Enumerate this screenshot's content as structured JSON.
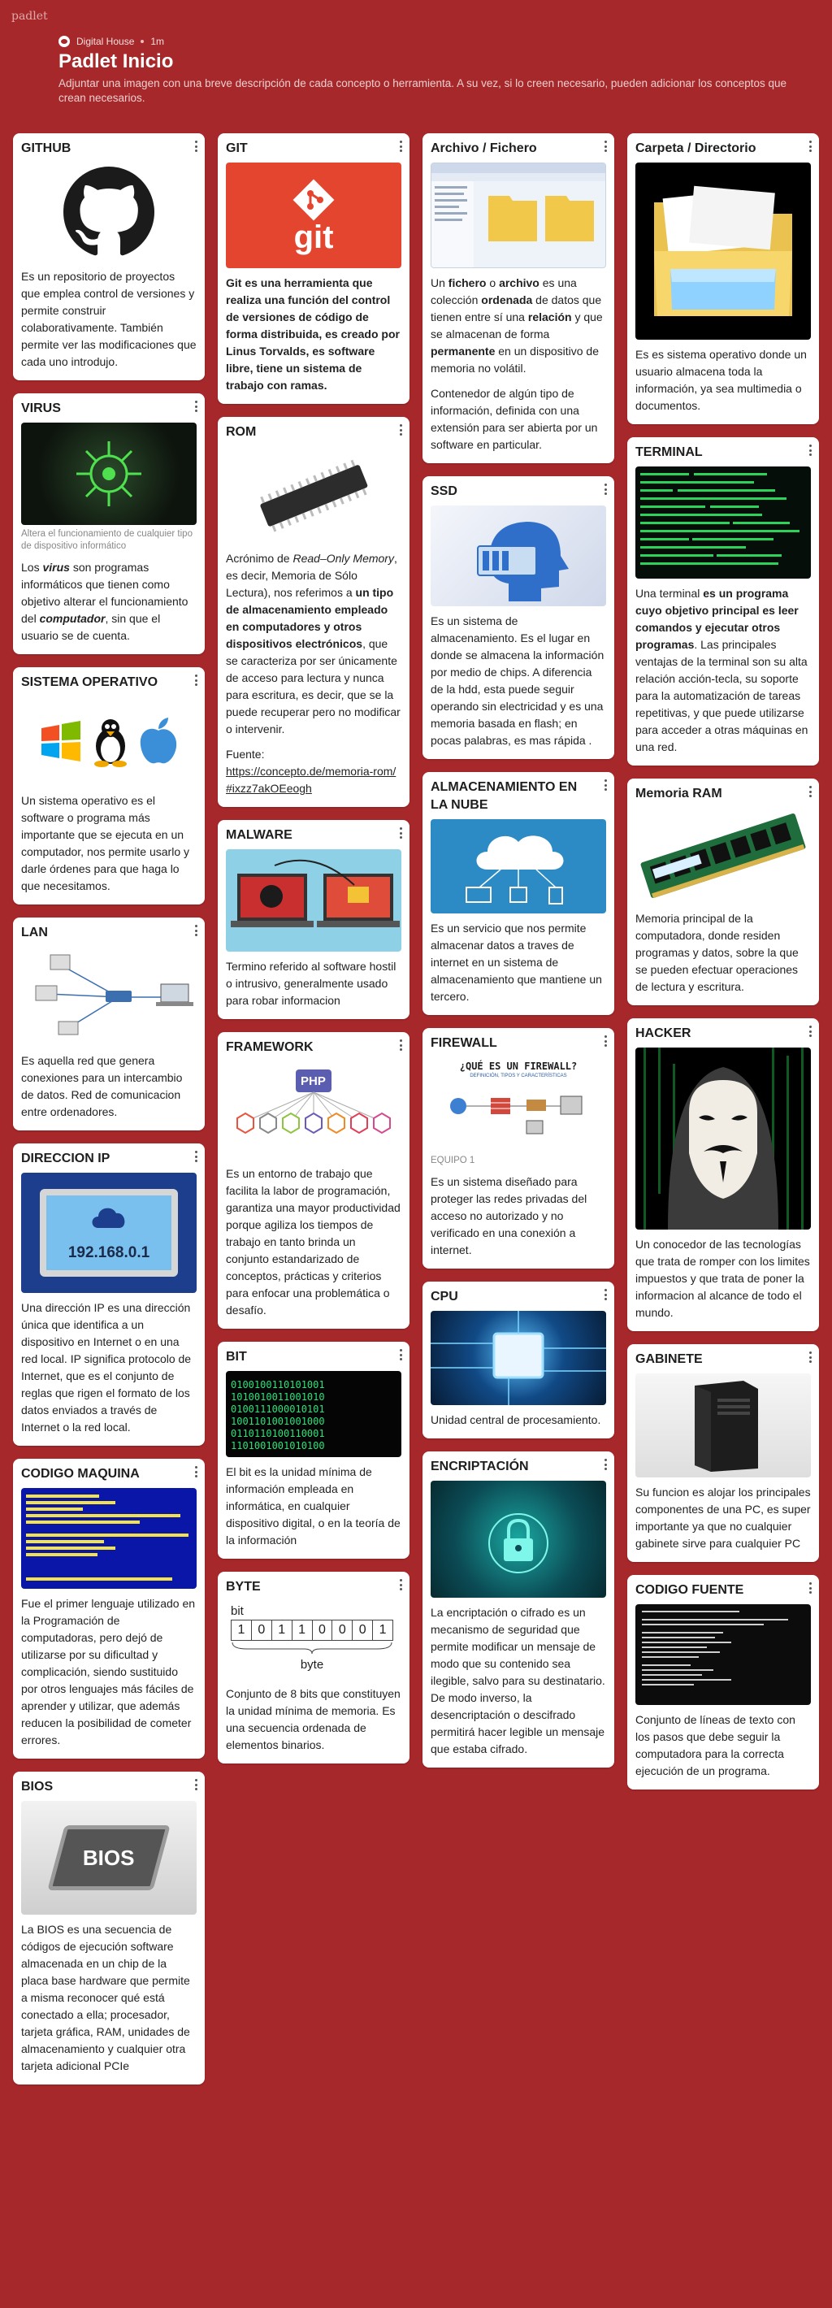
{
  "app": {
    "brand": "padlet"
  },
  "header": {
    "author": "Digital House",
    "time": "1m",
    "title": "Padlet Inicio",
    "description": "Adjuntar una imagen con una breve descripción de cada concepto o herramienta. A su vez, si lo creen necesario, pueden adicionar los conceptos que crean necesarios."
  },
  "colors": {
    "background": "#a7282a",
    "card": "#ffffff"
  },
  "cards": {
    "github": {
      "title": "GITHUB",
      "body": "Es un repositorio de proyectos que emplea control de versiones y permite construir colaborativamente. También permite ver las modificaciones que cada uno introdujo."
    },
    "virus": {
      "title": "VIRUS",
      "caption": "Altera el funcionamiento de cualquier tipo de dispositivo informático",
      "b1": "Los ",
      "b2": "virus",
      "b3": " son programas informáticos que tienen como objetivo alterar el funcionamiento del ",
      "b4": "computador",
      "b5": ", sin que el usuario se de cuenta."
    },
    "so": {
      "title": "SISTEMA OPERATIVO",
      "body": "Un sistema operativo es el software o programa más importante que se ejecuta en un computador, nos permite usarlo y darle órdenes para que haga lo que necesitamos."
    },
    "lan": {
      "title": "LAN",
      "body": "Es aquella red que genera conexiones para un intercambio de datos. Red de comunicacion entre ordenadores."
    },
    "ip": {
      "title": "DIRECCION IP",
      "img_text": "192.168.0.1",
      "body": "Una dirección IP es una dirección única que identifica a un dispositivo en Internet o en una red local. IP significa protocolo de Internet, que es el conjunto de reglas que rigen el formato de los datos enviados a través de Internet o la red local."
    },
    "codigo_maquina": {
      "title": "CODIGO MAQUINA",
      "body": "Fue el primer lenguaje utilizado en la Programación de computadoras, pero dejó de utilizarse por su dificultad y complicación, siendo sustituido por otros lenguajes más fáciles de aprender y utilizar, que además reducen la posibilidad de cometer errores."
    },
    "bios": {
      "title": "BIOS",
      "img_text": "BIOS",
      "body": "La BIOS es una secuencia de códigos de ejecución software almacenada en un chip de la placa base hardware que permite a misma reconocer qué está conectado a ella; procesador, tarjeta gráfica, RAM, unidades de almacenamiento y cualquier otra tarjeta adicional PCIe"
    },
    "git": {
      "title": "GIT",
      "img_text": "git",
      "body": "Git es una herramienta que realiza una función del control de versiones de código de forma distribuida, es creado por Linus Torvalds, es software libre, tiene un sistema de trabajo con ramas."
    },
    "rom": {
      "title": "ROM",
      "r1": "Acrónimo de ",
      "r2": "Read–Only Memory",
      "r3": ", es decir, Memoria de Sólo Lectura), nos referimos a ",
      "r4": "un tipo de almacenamiento empleado en computadores y otros dispositivos electrónicos",
      "r5": ", que se caracteriza por ser únicamente de acceso para lectura y nunca para escritura, es decir, que se la puede recuperar pero no modificar o intervenir.",
      "source_label": "Fuente:",
      "source_link": "https://concepto.de/memoria-rom/#ixzz7akOEeogh"
    },
    "malware": {
      "title": "MALWARE",
      "body": "Termino referido al software hostil o intrusivo, generalmente usado para robar informacion"
    },
    "framework": {
      "title": "FRAMEWORK",
      "img_text": "PHP",
      "body": "Es un entorno de trabajo que facilita la labor de programación, garantiza una mayor productividad porque agiliza los tiempos de trabajo en tanto brinda un conjunto estandarizado de conceptos, prácticas y criterios para enfocar una problemática o desafío."
    },
    "bit": {
      "title": "BIT",
      "body": "El bit es la unidad mínima de información empleada en informática, en cualquier dispositivo digital, o en la teoría de la información"
    },
    "byte": {
      "title": "BYTE",
      "img_bit": "bit",
      "img_byte": "byte",
      "bits": [
        "1",
        "0",
        "1",
        "1",
        "0",
        "0",
        "0",
        "1"
      ],
      "body": "Conjunto de 8 bits que constituyen la unidad mínima de memoria. Es una secuencia ordenada de elementos binarios."
    },
    "archivo": {
      "title": "Archivo / Fichero",
      "a1": "Un ",
      "a2": "fichero",
      "a3": " o ",
      "a4": "archivo",
      "a5": " es una colección ",
      "a6": "ordenada",
      "a7": " de datos que tienen entre sí una ",
      "a8": "relación",
      "a9": " y que se almacenan de forma ",
      "a10": "permanente",
      "a11": " en un dispositivo de memoria no volátil.",
      "p2": "Contenedor de algún tipo de información, definida con una extensión para ser abierta por un software en particular."
    },
    "ssd": {
      "title": "SSD",
      "body": "Es un sistema de almacenamiento. Es el lugar en donde se almacena la información por medio de chips. A diferencia de la hdd, esta puede seguir operando sin electricidad y es una memoria basada en flash; en pocas palabras, es mas rápida ."
    },
    "nube": {
      "title": "ALMACENAMIENTO EN LA NUBE",
      "body": "Es un servicio que nos permite almacenar datos a traves de internet en un sistema de almacenamiento que mantiene un tercero."
    },
    "firewall": {
      "title": "FIREWALL",
      "img_text": "¿QUÉ ES UN FIREWALL?",
      "img_sub": "DEFINICIÓN, TIPOS Y CARACTERÍSTICAS",
      "caption": "EQUIPO 1",
      "body": "Es un sistema diseñado para proteger las redes privadas del acceso no autorizado y no verificado en una conexión a internet."
    },
    "cpu": {
      "title": "CPU",
      "body": "Unidad central de procesamiento."
    },
    "encriptacion": {
      "title": "ENCRIPTACIÓN",
      "body": "La encriptación o cifrado es un mecanismo de seguridad que permite modificar un mensaje de modo que su contenido sea ilegible, salvo para su destinatario. De modo inverso, la desencriptación o descifrado permitirá hacer legible un mensaje que estaba cifrado."
    },
    "carpeta": {
      "title": "Carpeta / Directorio",
      "body": "Es es sistema operativo donde un usuario almacena toda la información, ya sea multimedia o documentos."
    },
    "terminal": {
      "title": "TERMINAL",
      "t1": "Una terminal ",
      "t2": "es un programa cuyo objetivo principal es leer comandos y ejecutar otros programas",
      "t3": ". Las principales ventajas de la terminal son su alta relación acción-tecla, su soporte para la automatización de tareas repetitivas, y que puede utilizarse para acceder a otras máquinas en una red."
    },
    "ram": {
      "title": "Memoria RAM",
      "body": "Memoria principal de la computadora, donde residen programas y datos, sobre la que se pueden efectuar operaciones de lectura y escritura."
    },
    "hacker": {
      "title": "HACKER",
      "body": "Un conocedor de las tecnologías que trata de romper con los limites impuestos y que trata de poner la informacion al alcance de todo el mundo."
    },
    "gabinete": {
      "title": "GABINETE",
      "body": "Su funcion es alojar los principales componentes de una PC, es super importante ya que no cualquier gabinete sirve para cualquier PC"
    },
    "codigo_fuente": {
      "title": "CODIGO FUENTE",
      "body": "Conjunto de líneas de texto con los pasos que debe seguir la computadora para la correcta ejecución de un programa."
    }
  }
}
